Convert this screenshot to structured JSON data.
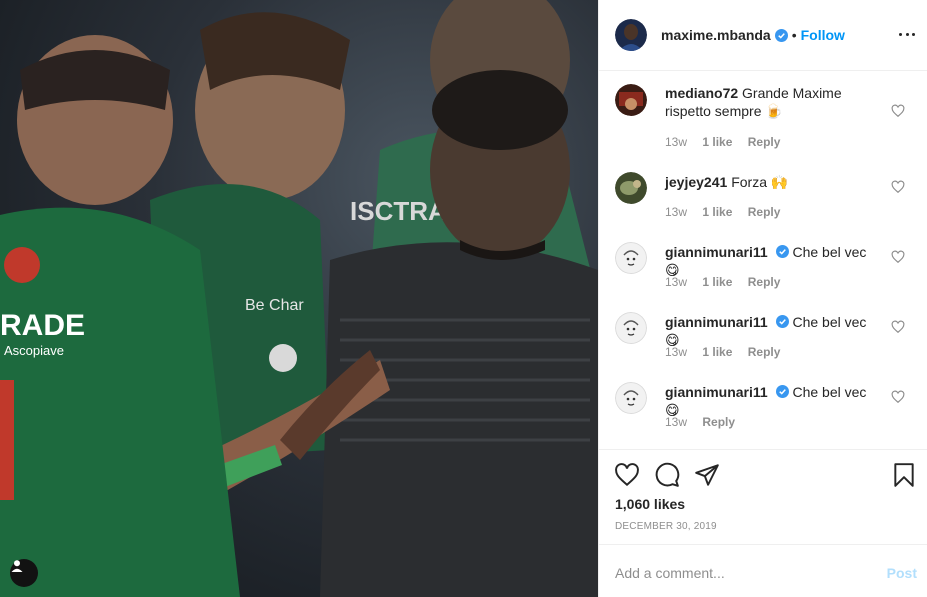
{
  "post": {
    "photo_alt_icon": "user-tag-icon",
    "author": "maxime.mbanda",
    "follow_label": "Follow",
    "separator": "•",
    "verified": true,
    "more_icon": "more-options-icon"
  },
  "comments": [
    {
      "user": "mediano72",
      "text": "Grande Maxime rispetto sempre 🍺",
      "age": "13w",
      "likes": "1 like",
      "reply": "Reply",
      "verified": false
    },
    {
      "user": "jeyjey241",
      "text": "Forza 🙌",
      "age": "13w",
      "likes": "1 like",
      "reply": "Reply",
      "verified": false
    },
    {
      "user": "giannimunari11",
      "text": "Che bel vec😋",
      "age": "13w",
      "likes": "1 like",
      "reply": "Reply",
      "verified": true
    },
    {
      "user": "giannimunari11",
      "text": "Che bel vec😋",
      "age": "13w",
      "likes": "1 like",
      "reply": "Reply",
      "verified": true
    },
    {
      "user": "giannimunari11",
      "text": "Che bel vec😋",
      "age": "13w",
      "likes": "",
      "reply": "Reply",
      "verified": true
    }
  ],
  "actions": {
    "like_icon": "heart-icon",
    "comment_icon": "comment-icon",
    "share_icon": "share-icon",
    "save_icon": "bookmark-icon"
  },
  "likes_text": "1,060 likes",
  "date_text": "DECEMBER 30, 2019",
  "add_comment": {
    "placeholder": "Add a comment...",
    "post_label": "Post"
  },
  "colors": {
    "accent": "#0095f6",
    "post_disabled": "#b2dffc",
    "muted": "#8e8e8e",
    "text": "#262626"
  }
}
